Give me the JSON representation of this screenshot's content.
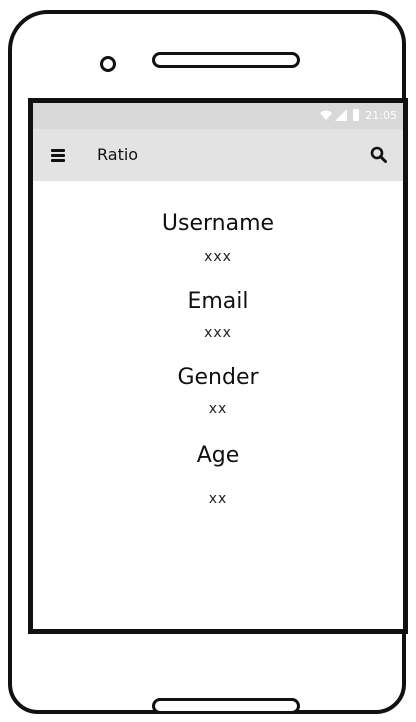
{
  "status_bar": {
    "time": "21:05"
  },
  "app_bar": {
    "title": "Ratio"
  },
  "profile": {
    "username_label": "Username",
    "username_value": "xxx",
    "email_label": "Email",
    "email_value": "xxx",
    "gender_label": "Gender",
    "gender_value": "xx",
    "age_label": "Age",
    "age_value": "xx"
  },
  "icons": {
    "menu": "hamburger-menu-icon",
    "search": "search-icon",
    "wifi": "wifi-icon",
    "signal": "signal-icon",
    "battery": "battery-icon"
  },
  "colors": {
    "status_bar": "#d8d8d8",
    "app_bar": "#e3e3e3",
    "outline": "#111111"
  }
}
